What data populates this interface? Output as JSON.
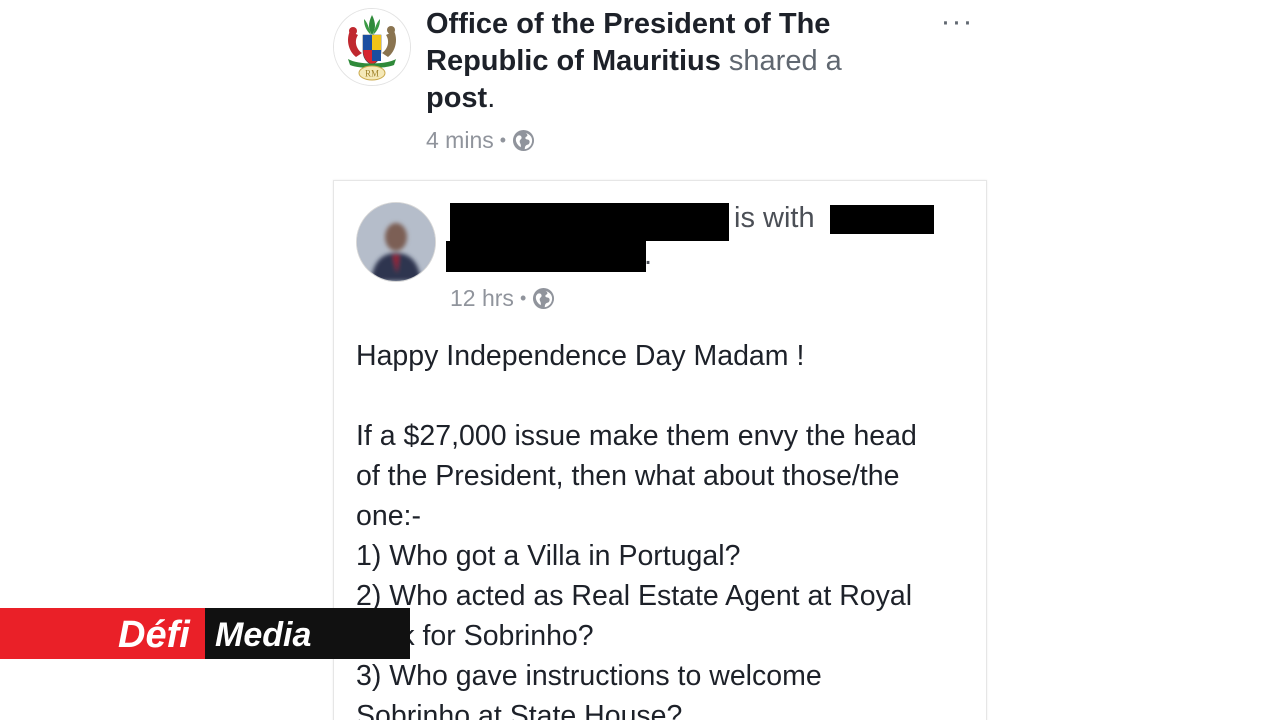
{
  "header": {
    "author_name": "Office of the President of The Republic of Mauritius",
    "shared_text": "shared a",
    "post_word": "post",
    "period": ".",
    "time": "4 mins",
    "dot": "•",
    "privacy_icon": "globe-icon",
    "more_icon": "more-options-icon",
    "more_glyph": "···"
  },
  "shared_post": {
    "with_text": "is with",
    "period": ".",
    "time": "12 hrs",
    "dot": "•",
    "privacy_icon": "globe-icon",
    "lines": [
      "Happy Independence Day Madam !",
      "",
      "If a $27,000 issue make them envy the head",
      "of the President, then what about those/the",
      "one:-",
      "1) Who got a Villa in Portugal?",
      "2) Who acted as Real Estate Agent at Royal",
      "Park for Sobrinho?",
      "3) Who gave instructions to welcome",
      "Sobrinho at State House?"
    ]
  },
  "seal": {
    "initials": "RM"
  },
  "watermark": {
    "brand_first": "Défi",
    "brand_second": "Media",
    "red": "#ea2028",
    "black": "#111111"
  }
}
